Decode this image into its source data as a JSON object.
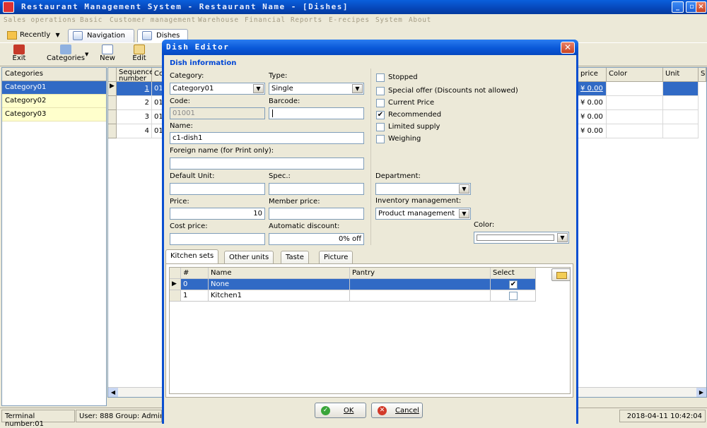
{
  "app": {
    "title": "Restaurant Management System - Restaurant Name - [Dishes]",
    "menu": [
      "Sales operations",
      "Basic",
      "Customer management",
      "Warehouse",
      "Financial",
      "Reports",
      "E-recipes",
      "System",
      "About"
    ]
  },
  "tabs": {
    "recently": "Recently",
    "navigation": "Navigation",
    "dishes": "Dishes"
  },
  "toolbar": {
    "exit": "Exit",
    "categories": "Categories",
    "new": "New",
    "edit": "Edit"
  },
  "left": {
    "header": "Categories",
    "items": [
      "Category01",
      "Category02",
      "Category03"
    ]
  },
  "grid": {
    "headers": {
      "seq": "Sequence number",
      "code": "Co",
      "price": "price",
      "color": "Color",
      "unit": "Unit",
      "sp": "Sp"
    },
    "rows": [
      {
        "seq": "1",
        "code": "01",
        "price": "¥ 0.00"
      },
      {
        "seq": "2",
        "code": "01",
        "price": "¥ 0.00"
      },
      {
        "seq": "3",
        "code": "01",
        "price": "¥ 0.00"
      },
      {
        "seq": "4",
        "code": "01",
        "price": "¥ 0.00"
      }
    ]
  },
  "status": {
    "terminal": "Terminal number:01",
    "user": "User: 888 Group: Admini",
    "datetime": "2018-04-11 10:42:04"
  },
  "dialog": {
    "title": "Dish Editor",
    "section": "Dish information",
    "labels": {
      "category": "Category:",
      "type": "Type:",
      "code": "Code:",
      "barcode": "Barcode:",
      "name": "Name:",
      "foreign": "Foreign name (for Print only):",
      "default_unit": "Default Unit:",
      "spec": "Spec.:",
      "price": "Price:",
      "member_price": "Member price:",
      "cost_price": "Cost price:",
      "auto_discount": "Automatic discount:",
      "department": "Department:",
      "inventory": "Inventory management:",
      "color": "Color:"
    },
    "values": {
      "category": "Category01",
      "type": "Single",
      "code": "01001",
      "barcode": "",
      "name": "c1-dish1",
      "foreign": "",
      "default_unit": "",
      "spec": "",
      "price": "10",
      "member_price": "",
      "cost_price": "",
      "auto_discount": "0% off",
      "department": "",
      "inventory": "Product management"
    },
    "checks": [
      {
        "label": "Stopped",
        "checked": false
      },
      {
        "label": "Special offer (Discounts not allowed)",
        "checked": false
      },
      {
        "label": "Current Price",
        "checked": false
      },
      {
        "label": "Recommended",
        "checked": true
      },
      {
        "label": "Limited supply",
        "checked": false
      },
      {
        "label": "Weighing",
        "checked": false
      }
    ],
    "tabs": [
      "Kitchen sets",
      "Other units",
      "Taste",
      "Picture"
    ],
    "kitchen": {
      "headers": {
        "num": "#",
        "name": "Name",
        "pantry": "Pantry",
        "select": "Select"
      },
      "rows": [
        {
          "num": "0",
          "name": "None",
          "pantry": "",
          "selected": true
        },
        {
          "num": "1",
          "name": "Kitchen1",
          "pantry": "",
          "selected": false
        }
      ]
    },
    "ok": "OK",
    "cancel": "Cancel"
  }
}
